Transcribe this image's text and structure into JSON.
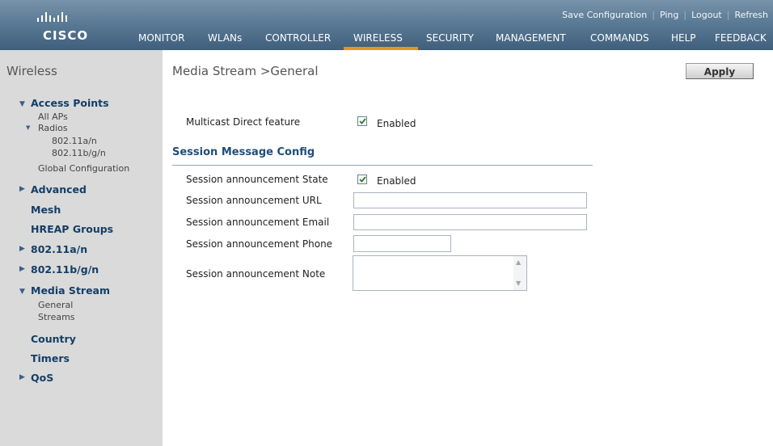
{
  "header": {
    "logo_text": "CISCO",
    "top_links": [
      "Save Configuration",
      "Ping",
      "Logout",
      "Refresh"
    ],
    "nav": [
      "MONITOR",
      "WLANs",
      "CONTROLLER",
      "WIRELESS",
      "SECURITY",
      "MANAGEMENT",
      "COMMANDS",
      "HELP",
      "FEEDBACK"
    ],
    "active_nav": "WIRELESS",
    "active_color": "#e8931f"
  },
  "sidebar": {
    "title": "Wireless",
    "access_points": "Access Points",
    "all_aps": "All APs",
    "radios": "Radios",
    "radio_a": "802.11a/n",
    "radio_bg": "802.11b/g/n",
    "global_config": "Global Configuration",
    "advanced": "Advanced",
    "mesh": "Mesh",
    "hreap": "HREAP Groups",
    "dot11a": "802.11a/n",
    "dot11bg": "802.11b/g/n",
    "media_stream": "Media Stream",
    "general": "General",
    "streams": "Streams",
    "country": "Country",
    "timers": "Timers",
    "qos": "QoS"
  },
  "page": {
    "title": "Media Stream >General",
    "apply_label": "Apply"
  },
  "form": {
    "multicast_label": "Multicast Direct feature",
    "multicast_checked": true,
    "multicast_check_label": "Enabled",
    "section_title": "Session Message Config",
    "state_label": "Session announcement State",
    "state_checked": true,
    "state_check_label": "Enabled",
    "url_label": "Session announcement URL",
    "url_value": "",
    "email_label": "Session announcement Email",
    "email_value": "",
    "phone_label": "Session announcement Phone",
    "phone_value": "",
    "note_label": "Session announcement Note",
    "note_value": ""
  }
}
